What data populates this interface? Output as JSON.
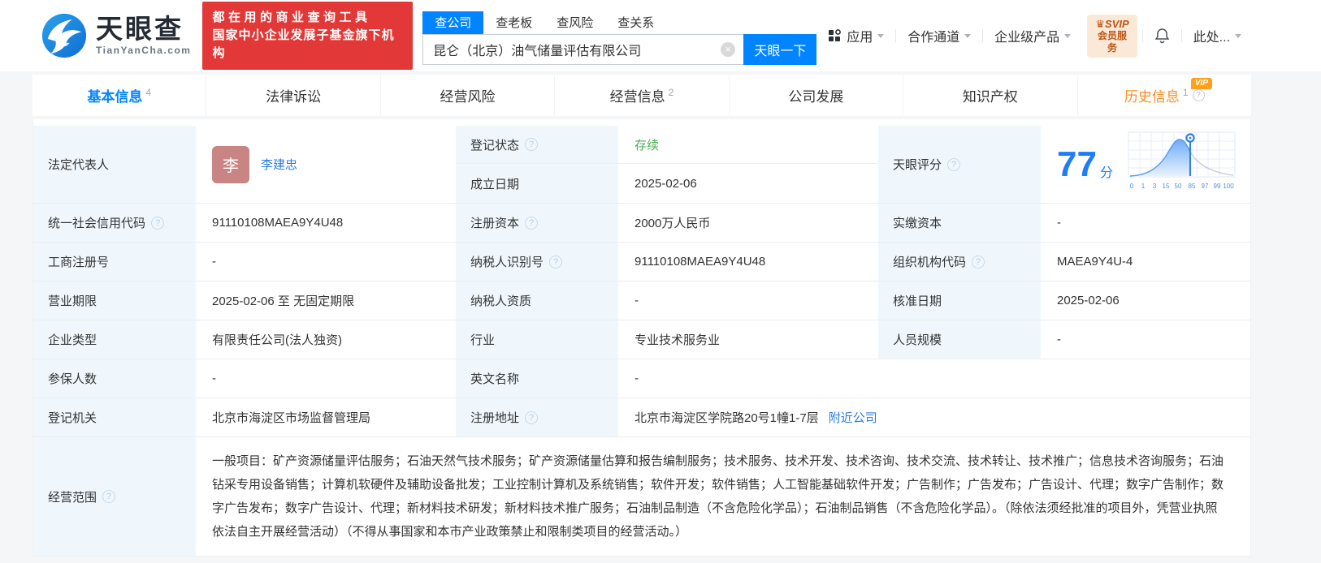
{
  "header": {
    "logo": {
      "brand": "天眼查",
      "domain": "TianYanCha.com"
    },
    "slogan": {
      "line1": "都在用的商业查询工具",
      "line2": "国家中小企业发展子基金旗下机构"
    },
    "search": {
      "tabs": [
        {
          "label": "查公司",
          "active": true
        },
        {
          "label": "查老板",
          "active": false
        },
        {
          "label": "查风险",
          "active": false
        },
        {
          "label": "查关系",
          "active": false
        }
      ],
      "value": "昆仑（北京）油气储量评估有限公司",
      "clear_icon": "×",
      "button": "天眼一下"
    },
    "nav": [
      {
        "label": "应用"
      },
      {
        "label": "合作通道"
      },
      {
        "label": "企业级产品"
      }
    ],
    "vip_badge": {
      "line1": "♛SVIP",
      "line2": "会员服务"
    },
    "user": "此处..."
  },
  "tabs": [
    {
      "label": "基本信息",
      "count": "4",
      "active": true
    },
    {
      "label": "法律诉讼"
    },
    {
      "label": "经营风险"
    },
    {
      "label": "经营信息",
      "count": "2"
    },
    {
      "label": "公司发展"
    },
    {
      "label": "知识产权"
    },
    {
      "label": "历史信息",
      "count": "1",
      "vip": "VIP",
      "help": "?"
    }
  ],
  "info": {
    "legal_rep": {
      "label": "法定代表人",
      "avatar": "李",
      "name": "李建忠"
    },
    "reg_status": {
      "label": "登记状态",
      "value": "存续"
    },
    "est_date": {
      "label": "成立日期",
      "value": "2025-02-06"
    },
    "score": {
      "label": "天眼评分",
      "value": "77",
      "unit": "分"
    },
    "credit_code": {
      "label": "统一社会信用代码",
      "value": "91110108MAEA9Y4U48"
    },
    "reg_capital": {
      "label": "注册资本",
      "value": "2000万人民币"
    },
    "paid_capital": {
      "label": "实缴资本",
      "value": "-"
    },
    "reg_number": {
      "label": "工商注册号",
      "value": "-"
    },
    "taxpayer_id": {
      "label": "纳税人识别号",
      "value": "91110108MAEA9Y4U48"
    },
    "org_code": {
      "label": "组织机构代码",
      "value": "MAEA9Y4U-4"
    },
    "business_term": {
      "label": "营业期限",
      "value": "2025-02-06 至 无固定期限"
    },
    "taxpayer_quality": {
      "label": "纳税人资质",
      "value": "-"
    },
    "approval_date": {
      "label": "核准日期",
      "value": "2025-02-06"
    },
    "company_type": {
      "label": "企业类型",
      "value": "有限责任公司(法人独资)"
    },
    "industry": {
      "label": "行业",
      "value": "专业技术服务业"
    },
    "staff_size": {
      "label": "人员规模",
      "value": "-"
    },
    "insured_count": {
      "label": "参保人数",
      "value": "-"
    },
    "english_name": {
      "label": "英文名称",
      "value": "-"
    },
    "reg_authority": {
      "label": "登记机关",
      "value": "北京市海淀区市场监督管理局"
    },
    "reg_address": {
      "label": "注册地址",
      "value": "北京市海淀区学院路20号1幢1-7层",
      "link": "附近公司"
    },
    "business_scope": {
      "label": "经营范围",
      "value": "一般项目：矿产资源储量评估服务；石油天然气技术服务；矿产资源储量估算和报告编制服务；技术服务、技术开发、技术咨询、技术交流、技术转让、技术推广；信息技术咨询服务；石油钻采专用设备销售；计算机软硬件及辅助设备批发；工业控制计算机及系统销售；软件开发；软件销售；人工智能基础软件开发；广告制作；广告发布；广告设计、代理；数字广告制作；数字广告发布；数字广告设计、代理；新材料技术研发；新材料技术推广服务；石油制品制造（不含危险化学品）；石油制品销售（不含危险化学品）。（除依法须经批准的项目外，凭营业执照依法自主开展经营活动）（不得从事国家和本市产业政策禁止和限制类项目的经营活动。）"
    }
  },
  "chart_data": {
    "type": "area",
    "title": "天眼评分分布曲线",
    "score": 77,
    "marker_percentile": 77,
    "x_ticks": [
      "0",
      "1",
      "3",
      "15",
      "50",
      "85",
      "97",
      "99",
      "100"
    ],
    "grid": true,
    "fill_color": "#8abbf8",
    "line_color": "#5598f0",
    "tail_color": "#c9cdd4",
    "marker_color": "#2f7de1"
  },
  "colors": {
    "accent": "#0084ff",
    "link": "#2e7ce5",
    "status_green": "#4caf50",
    "history_orange": "#ff8e26",
    "slogan_red": "#e23837",
    "score_blue": "#1e7df7",
    "label_bg": "#f0f7fc"
  }
}
